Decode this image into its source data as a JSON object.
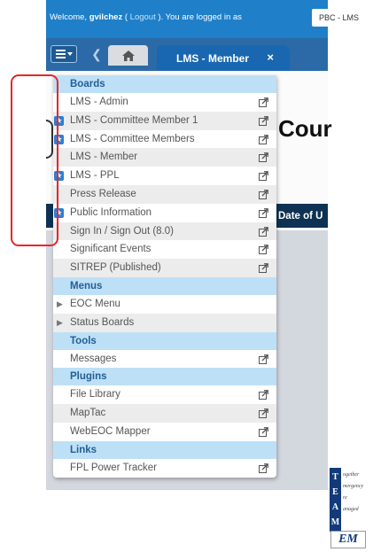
{
  "header": {
    "welcome_prefix": "Welcome, ",
    "username": "gvilchez",
    "logout_open": " ( ",
    "logout_label": "Logout",
    "logged_in_text": " ). You are logged in as",
    "position_select": "PBC - LMS"
  },
  "tabs": {
    "active_label": "LMS - Member",
    "close_symbol": "×"
  },
  "background": {
    "title_fragment": "Cour",
    "column_header_fragment": "Date of U"
  },
  "menu": {
    "boards_heading": "Boards",
    "boards": [
      {
        "label": "LMS - Admin",
        "starred": false
      },
      {
        "label": "LMS - Committee Member 1",
        "starred": true
      },
      {
        "label": "LMS - Committee Members",
        "starred": true
      },
      {
        "label": "LMS - Member",
        "starred": false
      },
      {
        "label": "LMS - PPL",
        "starred": true
      },
      {
        "label": "Press Release",
        "starred": false
      },
      {
        "label": "Public Information",
        "starred": true
      },
      {
        "label": "Sign In / Sign Out (8.0)",
        "starred": false
      },
      {
        "label": "Significant Events",
        "starred": false
      },
      {
        "label": "SITREP (Published)",
        "starred": false
      }
    ],
    "menus_heading": "Menus",
    "menus": [
      {
        "label": "EOC Menu"
      },
      {
        "label": "Status Boards"
      }
    ],
    "tools_heading": "Tools",
    "tools": [
      {
        "label": "Messages"
      }
    ],
    "plugins_heading": "Plugins",
    "plugins": [
      {
        "label": "File Library"
      },
      {
        "label": "MapTac"
      },
      {
        "label": "WebEOC Mapper"
      }
    ],
    "links_heading": "Links",
    "links": [
      {
        "label": "FPL Power Tracker"
      }
    ]
  },
  "logo": {
    "letters": [
      "T",
      "E",
      "A",
      "M"
    ],
    "words": [
      "ogether",
      "mergency",
      "re",
      "anaged"
    ],
    "badge": "EM"
  },
  "colors": {
    "top_bar": "#1f7fc9",
    "tab_bar": "#2b6aa6",
    "active_tab": "#1a67b1",
    "section_header_bg": "#bde0f7",
    "section_header_text": "#235e97",
    "star_badge": "#2c7fd1",
    "annotation_box": "#e8262b",
    "dark_header": "#0e3254"
  },
  "icons": {
    "menu": "hamburger-icon",
    "back": "chevron-left-icon",
    "home": "home-icon",
    "close": "close-icon",
    "star": "star-icon",
    "expand": "caret-right-icon",
    "popout": "external-link-icon"
  }
}
